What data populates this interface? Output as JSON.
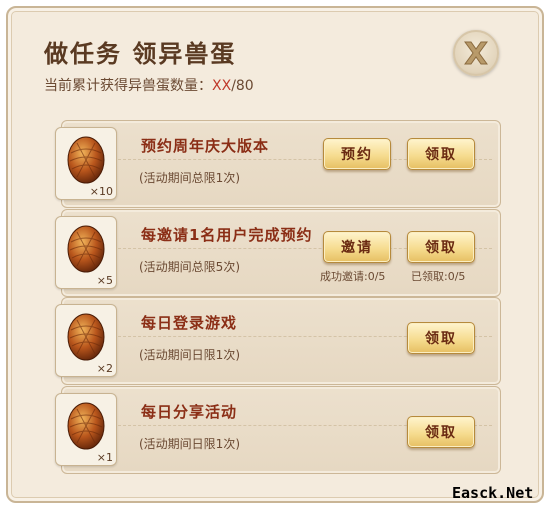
{
  "header": {
    "title": "做任务 领异兽蛋",
    "progress_label": "当前累计获得异兽蛋数量：",
    "progress_current": "XX",
    "progress_total": "/80",
    "close_icon": "close-x-icon"
  },
  "tasks": [
    {
      "name": "预约周年庆大版本",
      "limit": "(活动期间总限1次)",
      "reward_count": "×10",
      "icon": "dragon-egg-icon",
      "primary_button": "预约",
      "claim_button": "领取"
    },
    {
      "name": "每邀请1名用户完成预约",
      "limit": "(活动期间总限5次)",
      "reward_count": "×5",
      "icon": "dragon-egg-icon",
      "primary_button": "邀请",
      "claim_button": "领取",
      "invite_progress": "成功邀请:0/5",
      "claim_progress": "已领取:0/5"
    },
    {
      "name": "每日登录游戏",
      "limit": "(活动期间日限1次)",
      "reward_count": "×2",
      "icon": "dragon-egg-icon",
      "claim_button": "领取"
    },
    {
      "name": "每日分享活动",
      "limit": "(活动期间日限1次)",
      "reward_count": "×1",
      "icon": "dragon-egg-icon",
      "claim_button": "领取"
    }
  ],
  "watermark": "Easck.Net",
  "colors": {
    "panel_bg": "#f4ebdd",
    "title": "#5a3a22",
    "task_name": "#8b2e16",
    "highlight": "#c0392b",
    "button_gold": "#f6dc90"
  }
}
